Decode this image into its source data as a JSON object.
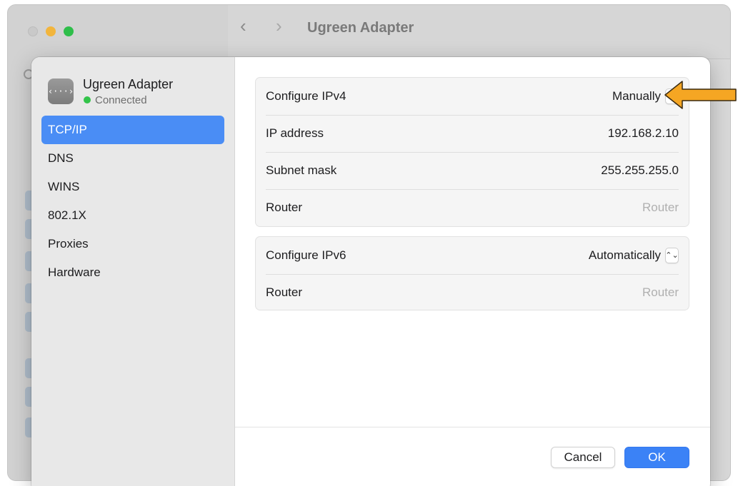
{
  "background_window": {
    "title": "Ugreen Adapter",
    "back_glyph": "‹",
    "forward_glyph": "›"
  },
  "sheet": {
    "adapter": {
      "icon_glyph": "‹···›",
      "name": "Ugreen Adapter",
      "status": "Connected",
      "status_color": "#33c44a"
    },
    "sidebar": {
      "items": [
        {
          "label": "TCP/IP",
          "active": true
        },
        {
          "label": "DNS"
        },
        {
          "label": "WINS"
        },
        {
          "label": "802.1X"
        },
        {
          "label": "Proxies"
        },
        {
          "label": "Hardware"
        }
      ]
    },
    "ipv4": {
      "configure_label": "Configure IPv4",
      "configure_value": "Manually",
      "ip_label": "IP address",
      "ip_value": "192.168.2.10",
      "subnet_label": "Subnet mask",
      "subnet_value": "255.255.255.0",
      "router_label": "Router",
      "router_placeholder": "Router"
    },
    "ipv6": {
      "configure_label": "Configure IPv6",
      "configure_value": "Automatically",
      "router_label": "Router",
      "router_placeholder": "Router"
    },
    "stepper_glyph": "⌃⌄",
    "buttons": {
      "cancel": "Cancel",
      "ok": "OK"
    }
  },
  "colors": {
    "accent": "#3b82f6",
    "selection": "#4a8df5",
    "annotation_arrow": "#f5a623"
  }
}
